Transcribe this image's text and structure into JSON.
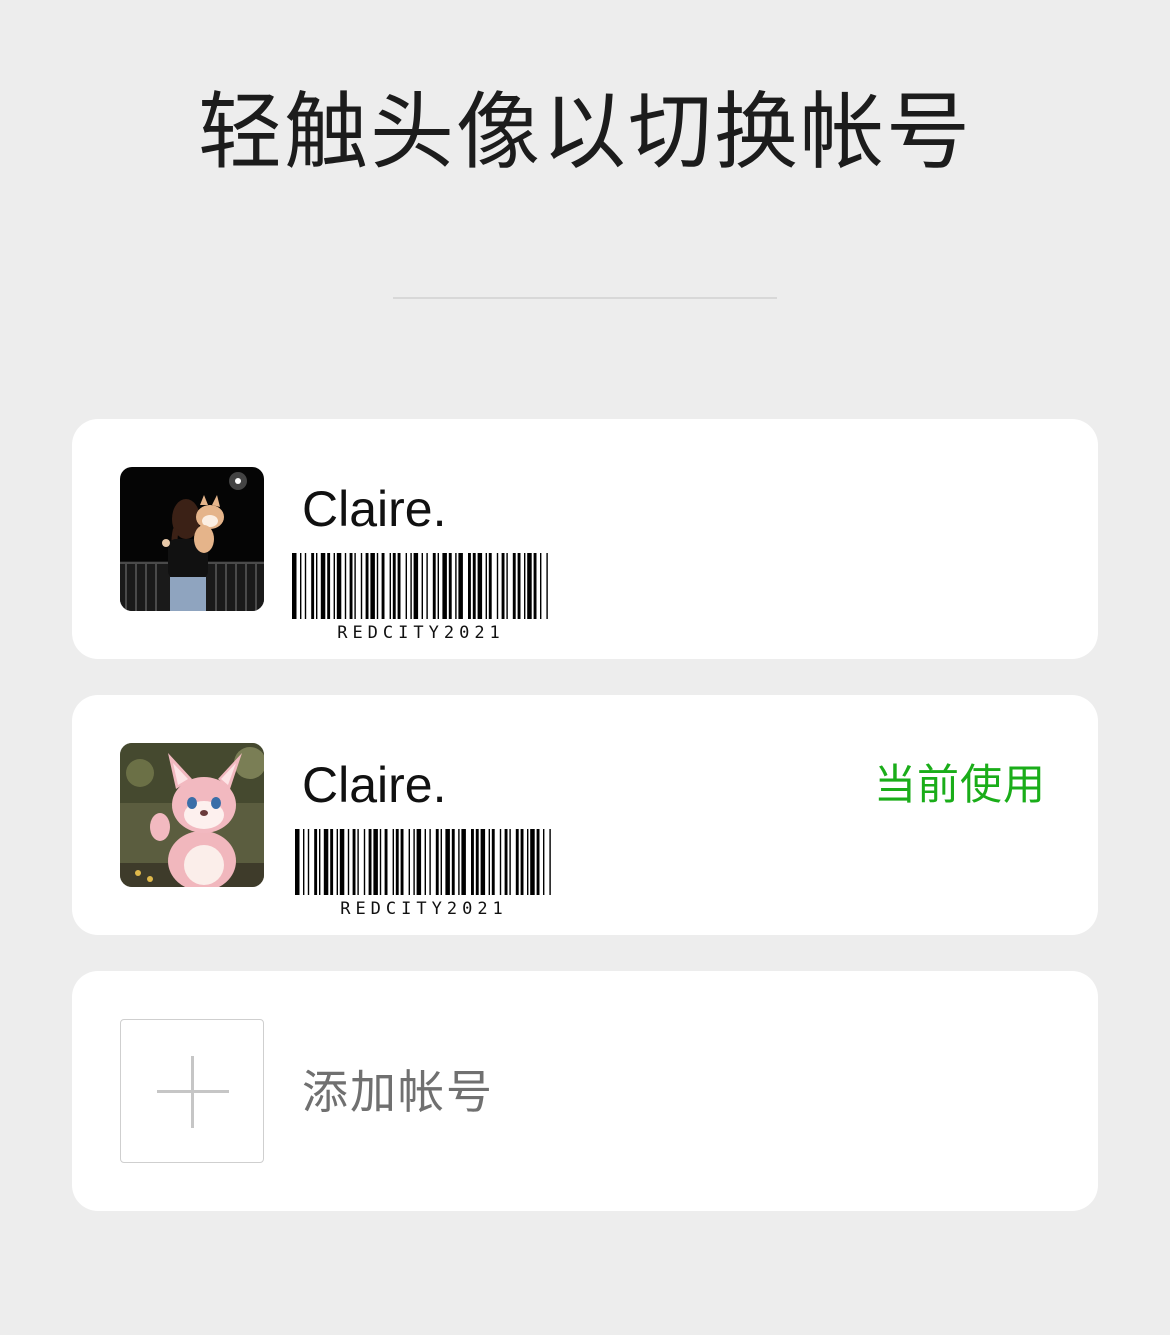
{
  "header": {
    "title": "轻触头像以切换帐号"
  },
  "accounts": [
    {
      "name": "Claire.",
      "barcode_text": "REDCITY2021",
      "avatar_icon": "girl-with-dog-night-photo",
      "status": ""
    },
    {
      "name": "Claire.",
      "barcode_text": "REDCITY2021",
      "avatar_icon": "pink-fox-plush-photo",
      "status": "当前使用"
    }
  ],
  "add_account": {
    "label": "添加帐号",
    "icon": "plus-icon"
  },
  "colors": {
    "background": "#ededed",
    "card": "#ffffff",
    "current_status": "#1aad19",
    "add_label": "#707070"
  }
}
